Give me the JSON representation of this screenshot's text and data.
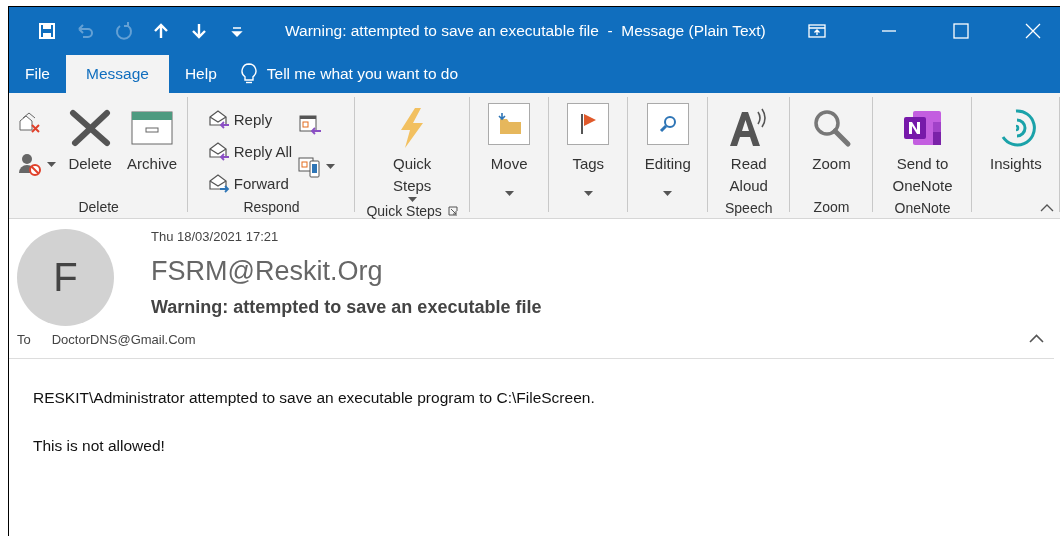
{
  "quick_access": [
    {
      "kind": "save",
      "disabled": false
    },
    {
      "kind": "undo",
      "disabled": true
    },
    {
      "kind": "redo",
      "disabled": true
    },
    {
      "kind": "up",
      "disabled": false
    },
    {
      "kind": "down",
      "disabled": false
    },
    {
      "kind": "customize",
      "disabled": false
    }
  ],
  "window": {
    "title": "Warning: attempted to save an executable file  -  Message (Plain Text)"
  },
  "tabs": [
    {
      "label": "File",
      "selected": false
    },
    {
      "label": "Message",
      "selected": true
    },
    {
      "label": "Help",
      "selected": false
    }
  ],
  "tell_me": {
    "placeholder": "Tell me what you want to do"
  },
  "ribbon": [
    {
      "label": "Delete",
      "items": [
        {
          "kind": "iconstack"
        },
        {
          "kind": "large",
          "lines": [
            "Delete"
          ]
        },
        {
          "kind": "large",
          "lines": [
            "Archive"
          ]
        }
      ]
    },
    {
      "label": "Respond",
      "items": [
        {
          "kind": "list",
          "entries": [
            "Reply",
            "Reply All",
            "Forward"
          ]
        },
        {
          "kind": "iconstack"
        }
      ]
    },
    {
      "label": "Quick Steps",
      "launcher": true,
      "items": [
        {
          "kind": "large",
          "lines": [
            "Quick",
            "Steps"
          ],
          "dropdown": true
        }
      ]
    },
    {
      "items": [
        {
          "kind": "boxed",
          "lines": [
            "Move"
          ],
          "dropdown": true
        }
      ]
    },
    {
      "items": [
        {
          "kind": "boxed",
          "lines": [
            "Tags"
          ],
          "dropdown": true
        }
      ]
    },
    {
      "items": [
        {
          "kind": "boxed",
          "lines": [
            "Editing"
          ],
          "dropdown": true
        }
      ]
    },
    {
      "label": "Speech",
      "items": [
        {
          "kind": "large",
          "lines": [
            "Read",
            "Aloud"
          ]
        }
      ]
    },
    {
      "label": "Zoom",
      "items": [
        {
          "kind": "large",
          "lines": [
            "Zoom"
          ]
        }
      ]
    },
    {
      "label": "OneNote",
      "items": [
        {
          "kind": "large",
          "lines": [
            "Send to",
            "OneNote"
          ]
        }
      ]
    },
    {
      "items": [
        {
          "kind": "large",
          "lines": [
            "Insights"
          ]
        }
      ]
    }
  ],
  "message": {
    "avatar": "F",
    "date": "Thu 18/03/2021 17:21",
    "sender": "FSRM@Reskit.Org",
    "subject": "Warning: attempted to save an executable file",
    "to_label": "To",
    "to": "DoctorDNS@Gmail.Com",
    "expanded": true
  },
  "body": [
    "RESKIT\\Administrator attempted to save an executable program to C:\\FileScreen.",
    "This is not allowed!"
  ]
}
